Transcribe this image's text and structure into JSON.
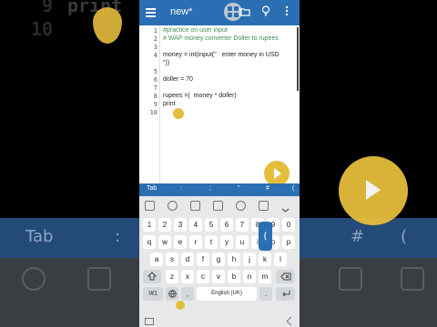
{
  "background": {
    "text_big_line_num_9": "9",
    "text_big_line_num_10": "10",
    "text_big_print": "print",
    "tab_label": "Tab",
    "hash_label": "#"
  },
  "app": {
    "title": "new*",
    "icons": [
      "menu-icon",
      "grid-icon",
      "folder-icon",
      "lightbulb-icon",
      "more-icon"
    ]
  },
  "editor": {
    "line_numbers": [
      "1",
      "2",
      "3",
      "4",
      "5",
      "6",
      "7",
      "8",
      "9",
      "10"
    ],
    "lines": [
      {
        "text": "#practice on user input",
        "kind": "comment"
      },
      {
        "text": "# WAP money converter Doller to rupees",
        "kind": "comment"
      },
      {
        "text": "",
        "kind": "code"
      },
      {
        "text": "money = int(input(\"   enter money in USD",
        "kind": "code"
      },
      {
        "text": "\"))",
        "kind": "code"
      },
      {
        "text": "doller = 70",
        "kind": "code"
      },
      {
        "text": "",
        "kind": "code"
      },
      {
        "text": "rupees =(  money * doller)",
        "kind": "code"
      },
      {
        "text": "print",
        "kind": "code"
      },
      {
        "text": "",
        "kind": "code"
      }
    ]
  },
  "symbol_bar": [
    "Tab",
    ":",
    ";",
    "\"",
    "#",
    "("
  ],
  "keyboard": {
    "numbers": [
      "1",
      "2",
      "3",
      "4",
      "5",
      "6",
      "7",
      "8",
      "9",
      "0"
    ],
    "row1": [
      "q",
      "w",
      "e",
      "r",
      "t",
      "y",
      "u",
      "i",
      "o",
      "p"
    ],
    "row2": [
      "a",
      "s",
      "d",
      "f",
      "g",
      "h",
      "j",
      "k",
      "l"
    ],
    "row3": [
      "z",
      "x",
      "c",
      "v",
      "b",
      "n",
      "m"
    ],
    "sym_key": "!#1",
    "comma_key": ",",
    "space_key": "English (UK)",
    "period_key": ".",
    "popup_char": "(",
    "popup_key": "k"
  },
  "colors": {
    "accent": "#2a6fb3",
    "tap_marker": "#e5bd3c"
  }
}
